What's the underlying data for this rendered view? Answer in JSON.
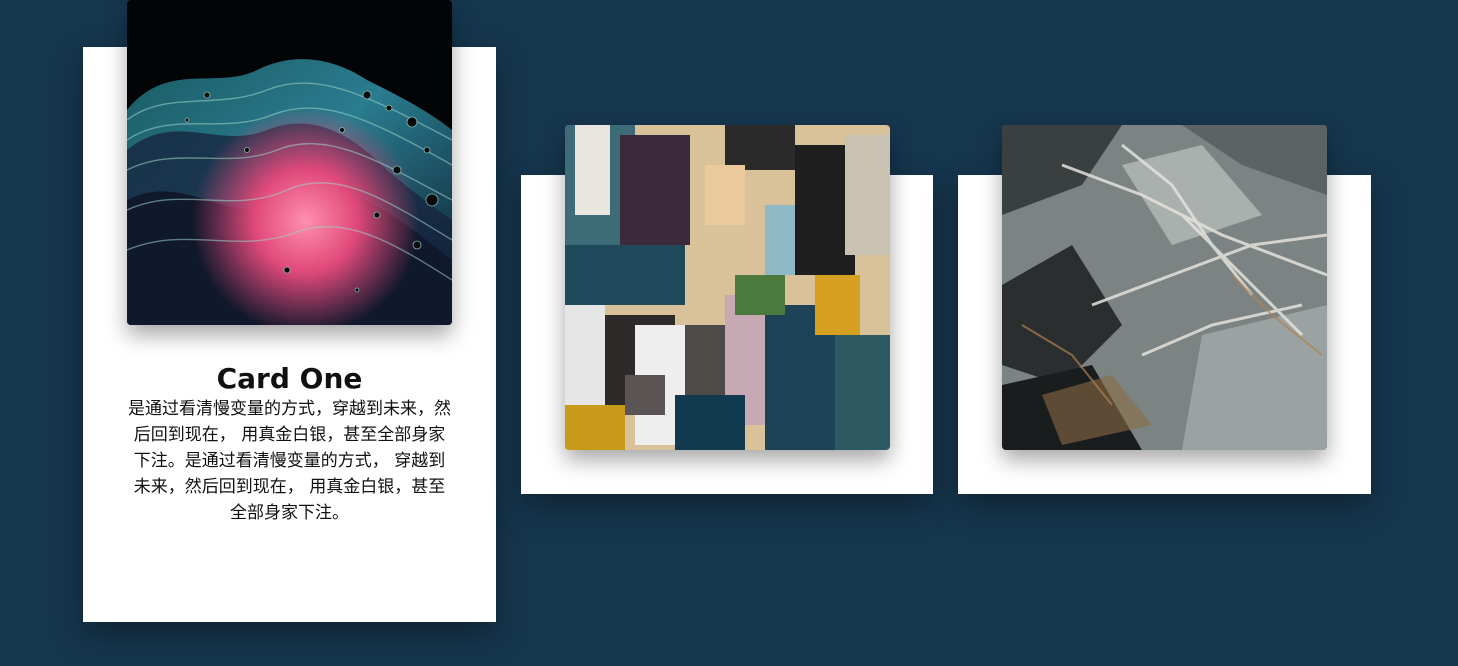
{
  "cards": [
    {
      "title": "Card One",
      "text": "是通过看清慢变量的方式，穿越到未来，然后回到现在， 用真金白银，甚至全部身家下注。是通过看清慢变量的方式， 穿越到未来，然后回到现在， 用真金白银，甚至全部身家下注。",
      "image": "abstract-fluid-paint-image"
    },
    {
      "image": "abstract-brushstroke-painting-image"
    },
    {
      "image": "grey-marble-stone-texture-image"
    }
  ],
  "colors": {
    "background": "#16364e",
    "card": "#ffffff",
    "text": "#111111"
  }
}
